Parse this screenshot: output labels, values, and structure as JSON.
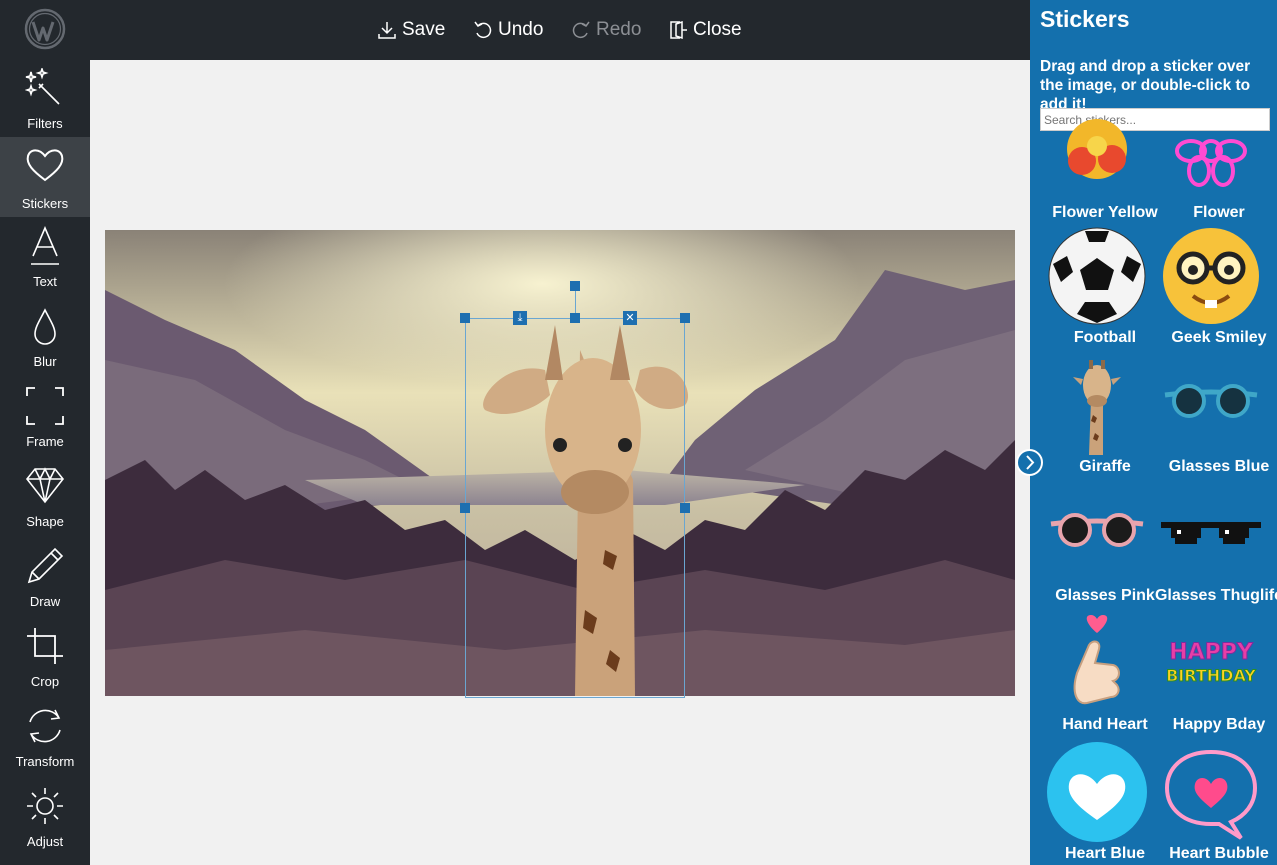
{
  "toolbar": {
    "save_label": "Save",
    "undo_label": "Undo",
    "redo_label": "Redo",
    "close_label": "Close"
  },
  "sidebar": {
    "items": [
      {
        "label": "Filters",
        "icon": "magic-wand-icon"
      },
      {
        "label": "Stickers",
        "icon": "heart-icon",
        "active": true
      },
      {
        "label": "Text",
        "icon": "text-icon"
      },
      {
        "label": "Blur",
        "icon": "drop-icon"
      },
      {
        "label": "Frame",
        "icon": "frame-icon"
      },
      {
        "label": "Shape",
        "icon": "diamond-icon"
      },
      {
        "label": "Draw",
        "icon": "pencil-icon"
      },
      {
        "label": "Crop",
        "icon": "crop-icon"
      },
      {
        "label": "Transform",
        "icon": "rotate-icon"
      },
      {
        "label": "Adjust",
        "icon": "brightness-icon"
      }
    ]
  },
  "panel": {
    "title": "Stickers",
    "description": "Drag and drop a sticker over the image, or double-click to add it!",
    "search_placeholder": "Search stickers...",
    "stickers": [
      {
        "label": "Flower Yellow"
      },
      {
        "label": "Flower"
      },
      {
        "label": "Football"
      },
      {
        "label": "Geek Smiley"
      },
      {
        "label": "Giraffe"
      },
      {
        "label": "Glasses Blue"
      },
      {
        "label": "Glasses Pink"
      },
      {
        "label": "Glasses Thuglife"
      },
      {
        "label": "Hand Heart"
      },
      {
        "label": "Happy Bday"
      },
      {
        "label": "Heart Blue"
      },
      {
        "label": "Heart Bubble"
      }
    ]
  },
  "colors": {
    "sidebar_bg": "#23282d",
    "panel_bg": "#1470ad",
    "canvas_bg": "#f1f1f1",
    "handle": "#1e6fb0"
  }
}
